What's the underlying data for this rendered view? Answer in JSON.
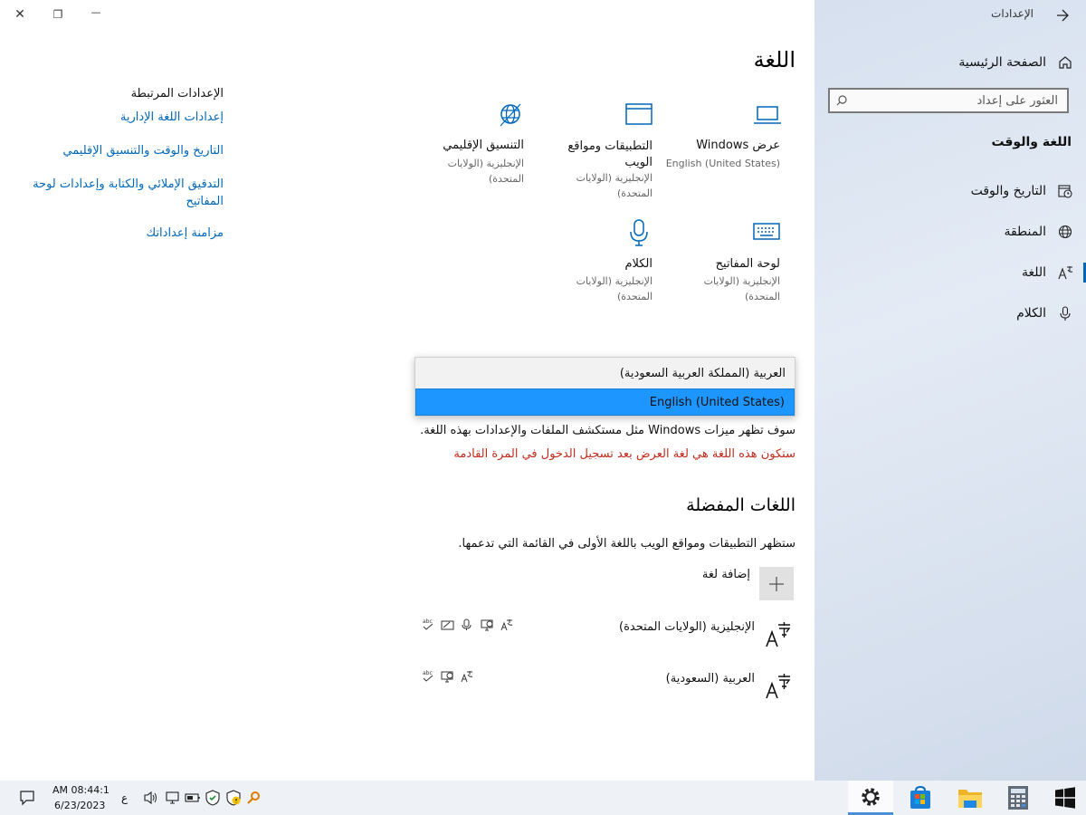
{
  "window": {
    "controls": {
      "close": "✕",
      "restore": "❐",
      "minimize": "—"
    }
  },
  "sidebar": {
    "back_label": "الإعدادات",
    "home_label": "الصفحة الرئيسية",
    "search_placeholder": "العثور على إعداد",
    "section_title": "اللغة والوقت",
    "items": [
      {
        "label": "التاريخ والوقت",
        "icon": "calendar-clock-icon"
      },
      {
        "label": "المنطقة",
        "icon": "globe-icon"
      },
      {
        "label": "اللغة",
        "icon": "language-icon",
        "selected": true
      },
      {
        "label": "الكلام",
        "icon": "microphone-icon"
      }
    ]
  },
  "main": {
    "page_title": "اللغة",
    "tiles": [
      {
        "title": "عرض Windows",
        "subtitle": "English (United States)",
        "icon": "laptop-icon"
      },
      {
        "title": "التطبيقات ومواقع الويب",
        "subtitle": "الإنجليزية (الولايات المتحدة)",
        "icon": "app-window-icon"
      },
      {
        "title": "التنسيق الإقليمي",
        "subtitle": "الإنجليزية (الولايات المتحدة)",
        "icon": "globe-grid-icon"
      },
      {
        "title": "لوحة المفاتيح",
        "subtitle": "الإنجليزية (الولايات المتحدة)",
        "icon": "keyboard-icon"
      },
      {
        "title": "الكلام",
        "subtitle": "الإنجليزية (الولايات المتحدة)",
        "icon": "microphone-icon"
      }
    ],
    "display_language": {
      "info_text": "سوف تظهر ميزات Windows مثل مستكشف الملفات والإعدادات بهذه اللغة.",
      "warning_text": "ستكون هذه اللغة هي لغة العرض بعد تسجيل الدخول في المرة القادمة"
    },
    "dropdown": {
      "options": [
        "العربية (المملكة العربية السعودية)",
        "English (United States)"
      ],
      "selected_index": 1
    },
    "preferred": {
      "title": "اللغات المفضلة",
      "description": "ستظهر التطبيقات ومواقع الويب باللغة الأولى في القائمة التي تدعمها.",
      "add_label": "إضافة لغة",
      "languages": [
        {
          "name": "الإنجليزية (الولايات المتحدة)",
          "features": [
            "language-icon",
            "display-icon",
            "microphone-icon",
            "handwriting-icon",
            "spellcheck-icon"
          ]
        },
        {
          "name": "العربية (السعودية)",
          "features": [
            "language-icon",
            "display-icon",
            "spellcheck-icon"
          ]
        }
      ]
    }
  },
  "related": {
    "title": "الإعدادات المرتبطة",
    "links": [
      "إعدادات اللغة الإدارية",
      "التاريخ والوقت والتنسيق الإقليمي",
      "التدقيق الإملائي والكتابة وإعدادات لوحة المفاتيح",
      "مزامنة إعداداتك"
    ]
  },
  "taskbar": {
    "time": "AM 08:44:1",
    "date": "6/23/2023",
    "input_indicator": "ع",
    "apps": [
      "settings-app",
      "store-app",
      "file-explorer-app",
      "calculator-app",
      "start-button"
    ]
  },
  "colors": {
    "accent": "#0067b8",
    "selection": "#1e96ff",
    "warning": "#c42b1c",
    "sidebar_bg": "#d6e0ef"
  }
}
